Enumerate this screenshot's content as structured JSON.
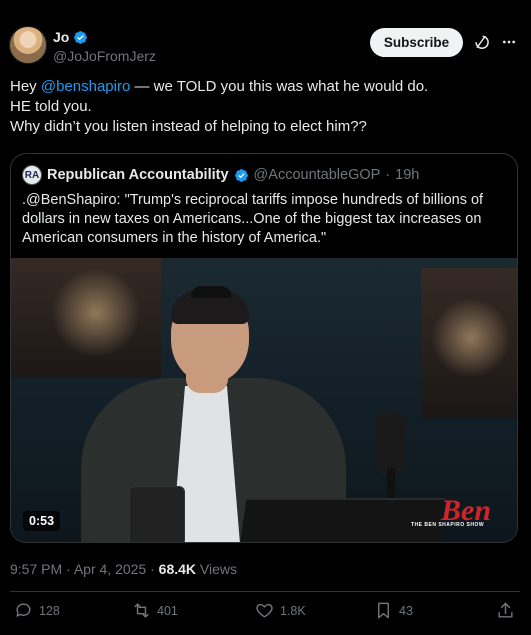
{
  "author": {
    "display_name": "Jo",
    "handle": "@JoJoFromJerz",
    "verified": true
  },
  "header": {
    "subscribe_label": "Subscribe",
    "icons": [
      "grok-icon",
      "more-icon"
    ]
  },
  "tweet": {
    "line1_prefix": "Hey ",
    "mention": "@benshapiro",
    "line1_suffix": " — we TOLD you this was what he would do.",
    "line2": "HE told you.",
    "line3": "Why didn’t you listen instead of helping to elect him??"
  },
  "quote": {
    "avatar_text": "RA",
    "display_name": "Republican Accountability",
    "handle": "@AccountableGOP",
    "separator": "·",
    "time": "19h",
    "text": ".@BenShapiro: \"Trump's reciprocal tariffs impose hundreds of billions of dollars in new taxes on Americans...One of the biggest tax increases on American consumers in the history of America.\"",
    "video": {
      "duration": "0:53",
      "logo_main": "Ben",
      "logo_sub": "THE BEN SHAPIRO SHOW"
    }
  },
  "meta": {
    "time": "9:57 PM",
    "separator": "·",
    "date": "Apr 4, 2025",
    "views_count": "68.4K",
    "views_label": "Views"
  },
  "actions": {
    "replies": "128",
    "reposts": "401",
    "likes": "1.8K",
    "bookmarks": "43"
  },
  "colors": {
    "background": "#000000",
    "text": "#e7e9ea",
    "secondary": "#71767b",
    "accent": "#1d9bf0",
    "border": "#2f3336"
  }
}
